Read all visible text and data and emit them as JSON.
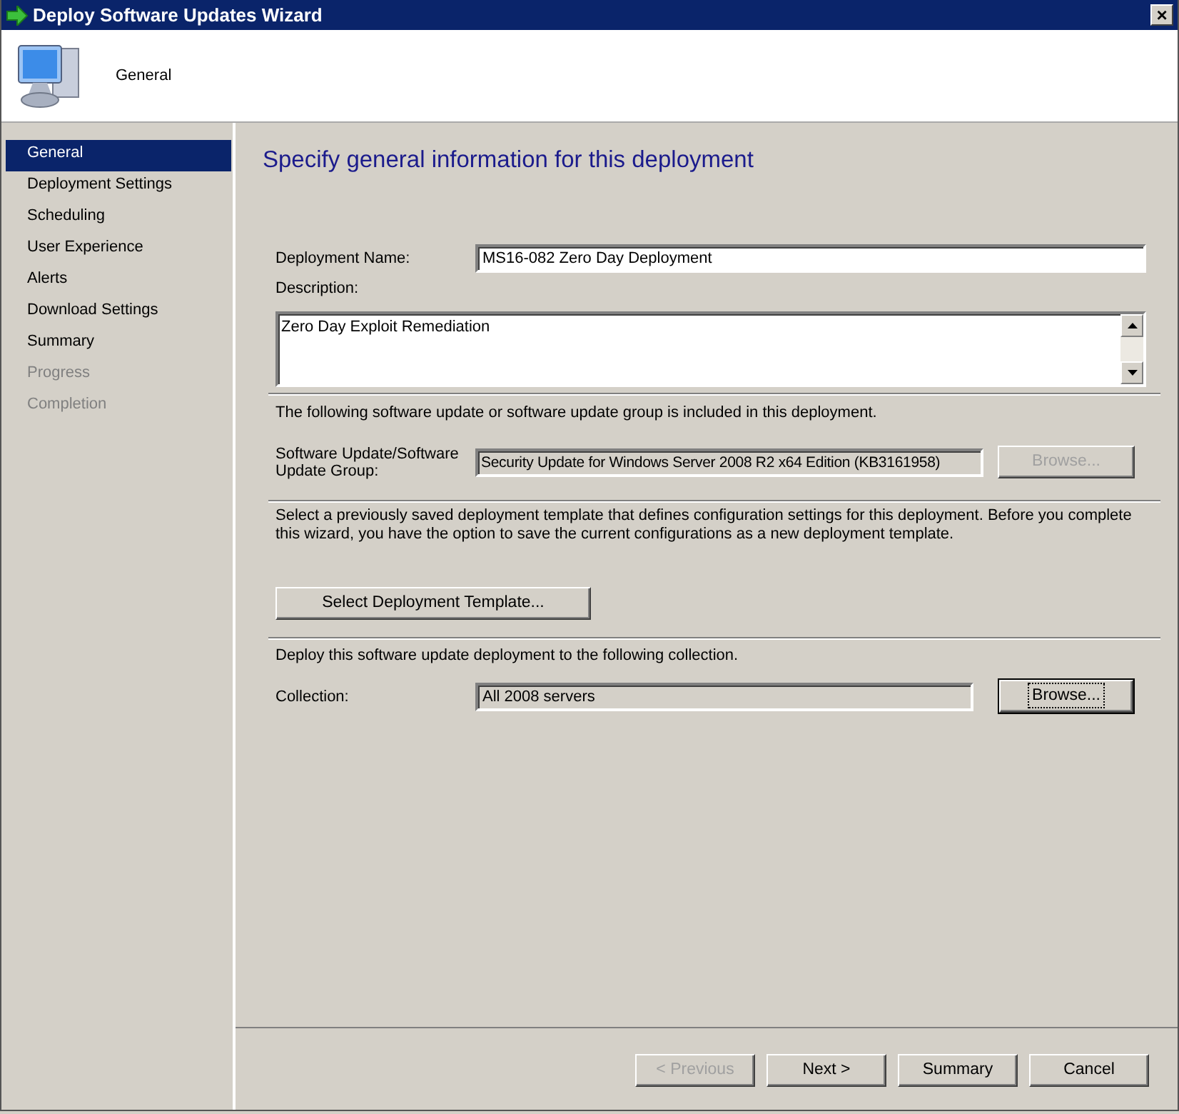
{
  "window": {
    "title": "Deploy Software Updates Wizard",
    "close": "×"
  },
  "header": {
    "title": "General"
  },
  "sidebar": {
    "items": [
      {
        "label": "General",
        "selected": true,
        "disabled": false
      },
      {
        "label": "Deployment Settings",
        "selected": false,
        "disabled": false
      },
      {
        "label": "Scheduling",
        "selected": false,
        "disabled": false
      },
      {
        "label": "User Experience",
        "selected": false,
        "disabled": false
      },
      {
        "label": "Alerts",
        "selected": false,
        "disabled": false
      },
      {
        "label": "Download Settings",
        "selected": false,
        "disabled": false
      },
      {
        "label": "Summary",
        "selected": false,
        "disabled": false
      },
      {
        "label": "Progress",
        "selected": false,
        "disabled": true
      },
      {
        "label": "Completion",
        "selected": false,
        "disabled": true
      }
    ]
  },
  "page": {
    "heading": "Specify general information for this deployment",
    "deployment_name": {
      "label": "Deployment Name:",
      "value": "MS16-082 Zero Day Deployment"
    },
    "description": {
      "label": "Description:",
      "value": "Zero Day Exploit Remediation"
    },
    "update_note": "The following software update or software update group is included in this deployment.",
    "software_update": {
      "label": "Software Update/Software Update Group:",
      "value": "Security Update for Windows Server 2008 R2 x64 Edition (KB3161958)",
      "button": {
        "label": "Browse...",
        "disabled": true,
        "focused": false
      }
    },
    "template_note": "Select a previously saved deployment template that defines configuration settings for this deployment. Before you complete this wizard, you have the option to save the current configurations as a new deployment template.",
    "template_button": {
      "label": "Select Deployment Template...",
      "disabled": false,
      "focused": false
    },
    "collection_note": "Deploy this software update deployment to the following collection.",
    "collection": {
      "label": "Collection:",
      "value": "All 2008 servers",
      "button": {
        "label": "Browse...",
        "disabled": false,
        "focused": true
      }
    }
  },
  "buttons": [
    {
      "label": "< Previous",
      "disabled": true,
      "focused": false
    },
    {
      "label": "Next >",
      "disabled": false,
      "focused": false
    },
    {
      "label": "Summary",
      "disabled": false,
      "focused": false
    },
    {
      "label": "Cancel",
      "disabled": false,
      "focused": false
    }
  ]
}
